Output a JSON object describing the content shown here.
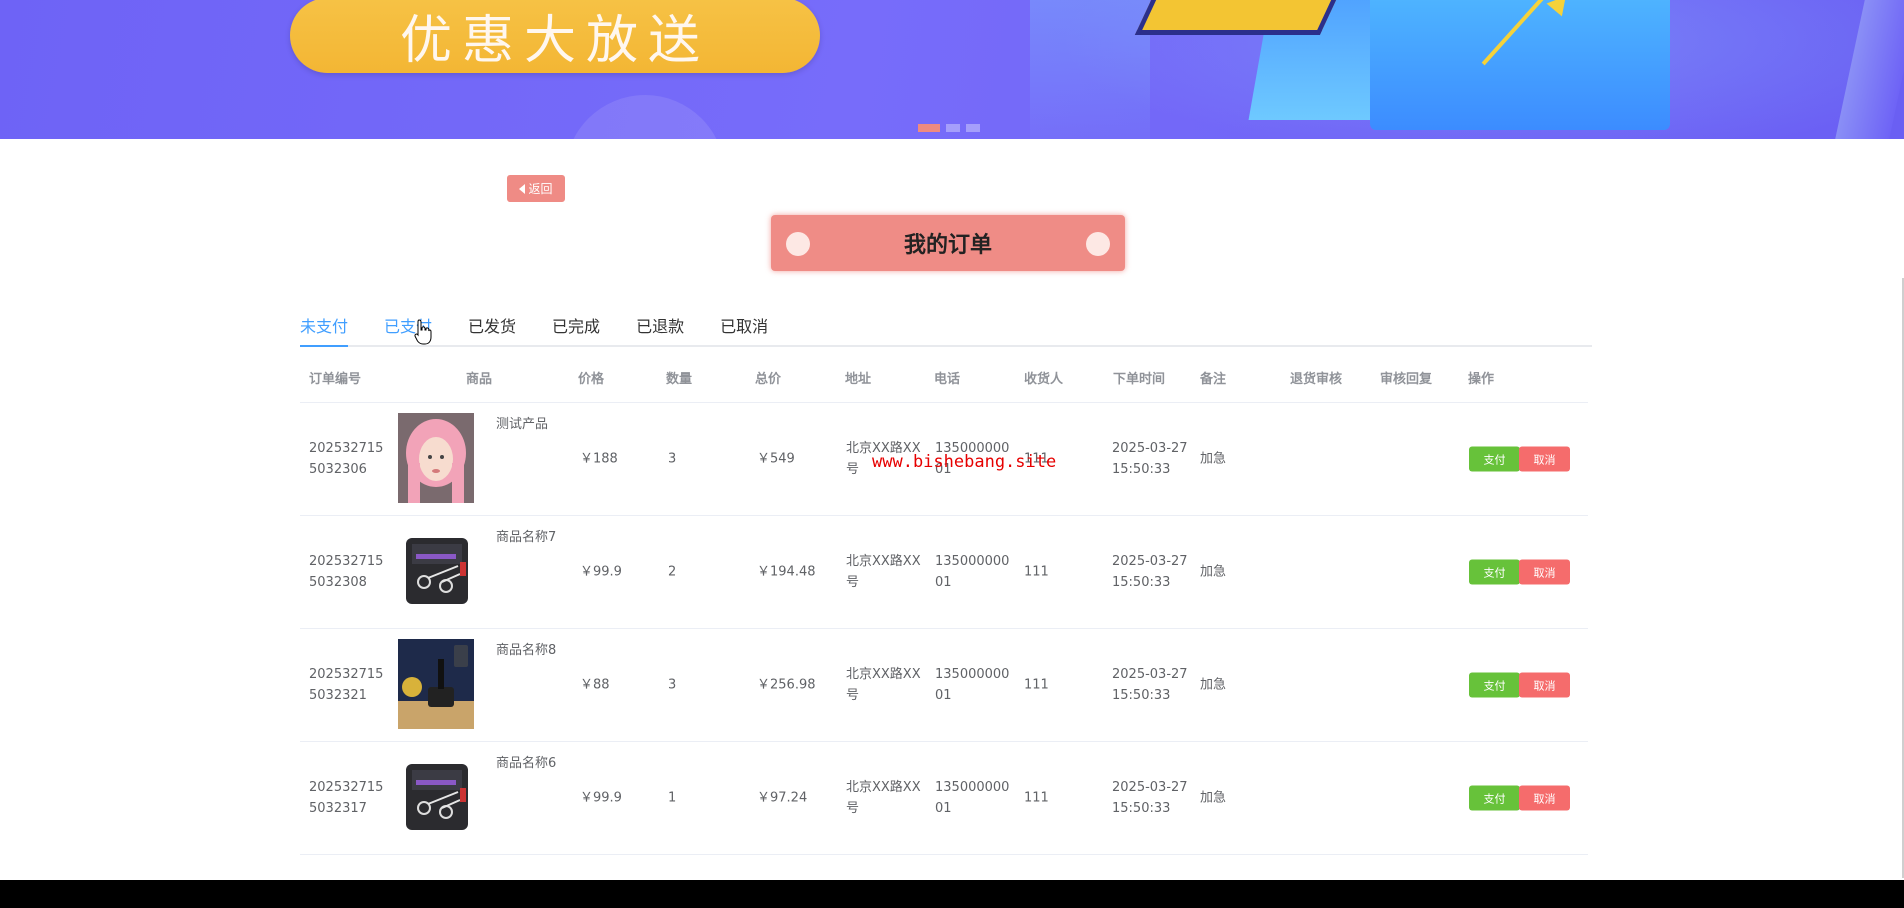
{
  "banner": {
    "promo_text": "优惠大放送",
    "carousel_active_index": 0,
    "carousel_count": 3
  },
  "back_button": {
    "label": "返回"
  },
  "page_title": "我的订单",
  "tabs": [
    {
      "label": "未支付",
      "active": true
    },
    {
      "label": "已支付",
      "active": false
    },
    {
      "label": "已发货",
      "active": false
    },
    {
      "label": "已完成",
      "active": false
    },
    {
      "label": "已退款",
      "active": false
    },
    {
      "label": "已取消",
      "active": false
    }
  ],
  "table": {
    "headers": [
      "订单编号",
      "商品",
      "价格",
      "数量",
      "总价",
      "地址",
      "电话",
      "收货人",
      "下单时间",
      "备注",
      "退货审核",
      "审核回复",
      "操作"
    ],
    "rows": [
      {
        "order_no_1": "202532715",
        "order_no_2": "5032306",
        "product": "测试产品",
        "image": "pink-hair-avatar",
        "price": "￥188",
        "qty": "3",
        "total": "￥549",
        "addr_1": "北京XX路XX",
        "addr_2": "号",
        "phone_1": "135000000",
        "phone_2": "01",
        "receiver": "111",
        "time_1": "2025-03-27",
        "time_2": "15:50:33",
        "remark": "加急",
        "return_review": "",
        "review_reply": ""
      },
      {
        "order_no_1": "202532715",
        "order_no_2": "5032308",
        "product": "商品名称7",
        "image": "scissors-kit",
        "price": "￥99.9",
        "qty": "2",
        "total": "￥194.48",
        "addr_1": "北京XX路XX",
        "addr_2": "号",
        "phone_1": "135000000",
        "phone_2": "01",
        "receiver": "111",
        "time_1": "2025-03-27",
        "time_2": "15:50:33",
        "remark": "加急",
        "return_review": "",
        "review_reply": ""
      },
      {
        "order_no_1": "202532715",
        "order_no_2": "5032321",
        "product": "商品名称8",
        "image": "hair-dryer-table",
        "price": "￥88",
        "qty": "3",
        "total": "￥256.98",
        "addr_1": "北京XX路XX",
        "addr_2": "号",
        "phone_1": "135000000",
        "phone_2": "01",
        "receiver": "111",
        "time_1": "2025-03-27",
        "time_2": "15:50:33",
        "remark": "加急",
        "return_review": "",
        "review_reply": ""
      },
      {
        "order_no_1": "202532715",
        "order_no_2": "5032317",
        "product": "商品名称6",
        "image": "scissors-kit",
        "price": "￥99.9",
        "qty": "1",
        "total": "￥97.24",
        "addr_1": "北京XX路XX",
        "addr_2": "号",
        "phone_1": "135000000",
        "phone_2": "01",
        "receiver": "111",
        "time_1": "2025-03-27",
        "time_2": "15:50:33",
        "remark": "加急",
        "return_review": "",
        "review_reply": ""
      }
    ],
    "actions": {
      "pay": "支付",
      "cancel": "取消"
    }
  },
  "watermark": "www.bishebang.site",
  "colors": {
    "banner": "#6e63f6",
    "accent_red": "#ef8c86",
    "tab_active": "#409eff",
    "pay": "#67c23a",
    "cancel": "#f56c6c"
  }
}
